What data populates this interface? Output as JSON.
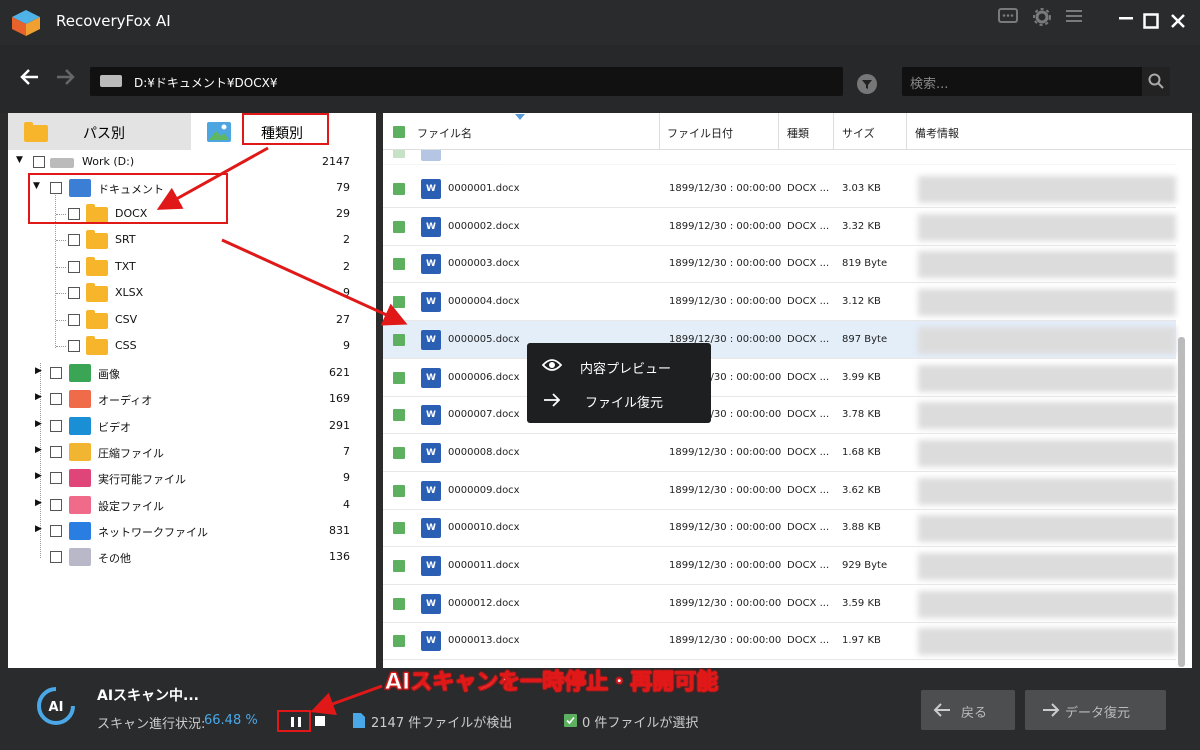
{
  "app": {
    "title": "RecoveryFox AI"
  },
  "nav": {
    "path": "D:¥ドキュメント¥DOCX¥",
    "search_placeholder": "検索..."
  },
  "left": {
    "tabs": {
      "path": "パス別",
      "type": "種類別"
    },
    "drive": {
      "name": "Work (D:)",
      "count": "2147"
    },
    "doc": {
      "name": "ドキュメント",
      "count": "79"
    },
    "subfolders": [
      {
        "name": "DOCX",
        "count": "29"
      },
      {
        "name": "SRT",
        "count": "2"
      },
      {
        "name": "TXT",
        "count": "2"
      },
      {
        "name": "XLSX",
        "count": "9"
      },
      {
        "name": "CSV",
        "count": "27"
      },
      {
        "name": "CSS",
        "count": "9"
      }
    ],
    "categories": [
      {
        "name": "画像",
        "count": "621",
        "color": "#3aa655"
      },
      {
        "name": "オーディオ",
        "count": "169",
        "color": "#f06b4a"
      },
      {
        "name": "ビデオ",
        "count": "291",
        "color": "#1a8fd6"
      },
      {
        "name": "圧縮ファイル",
        "count": "7",
        "color": "#f2b531"
      },
      {
        "name": "実行可能ファイル",
        "count": "9",
        "color": "#e0457a"
      },
      {
        "name": "設定ファイル",
        "count": "4",
        "color": "#f06b8a"
      },
      {
        "name": "ネットワークファイル",
        "count": "831",
        "color": "#2a7de1"
      },
      {
        "name": "その他",
        "count": "136",
        "color": "#b8b8c8"
      }
    ]
  },
  "table": {
    "headers": {
      "name": "ファイル名",
      "date": "ファイル日付",
      "type": "種類",
      "size": "サイズ",
      "note": "備考情報"
    },
    "rows": [
      {
        "name": "0000001.docx",
        "date": "1899/12/30 : 00:00:00",
        "type": "DOCX ...",
        "size": "3.03 KB"
      },
      {
        "name": "0000002.docx",
        "date": "1899/12/30 : 00:00:00",
        "type": "DOCX ...",
        "size": "3.32 KB"
      },
      {
        "name": "0000003.docx",
        "date": "1899/12/30 : 00:00:00",
        "type": "DOCX ...",
        "size": "819 Byte"
      },
      {
        "name": "0000004.docx",
        "date": "1899/12/30 : 00:00:00",
        "type": "DOCX ...",
        "size": "3.12 KB"
      },
      {
        "name": "0000005.docx",
        "date": "1899/12/30 : 00:00:00",
        "type": "DOCX ...",
        "size": "897 Byte"
      },
      {
        "name": "0000006.docx",
        "date": "1899/12/30 : 00:00:00",
        "type": "DOCX ...",
        "size": "3.99 KB"
      },
      {
        "name": "0000007.docx",
        "date": "1899/12/30 : 00:00:00",
        "type": "DOCX ...",
        "size": "3.78 KB"
      },
      {
        "name": "0000008.docx",
        "date": "1899/12/30 : 00:00:00",
        "type": "DOCX ...",
        "size": "1.68 KB"
      },
      {
        "name": "0000009.docx",
        "date": "1899/12/30 : 00:00:00",
        "type": "DOCX ...",
        "size": "3.62 KB"
      },
      {
        "name": "0000010.docx",
        "date": "1899/12/30 : 00:00:00",
        "type": "DOCX ...",
        "size": "3.88 KB"
      },
      {
        "name": "0000011.docx",
        "date": "1899/12/30 : 00:00:00",
        "type": "DOCX ...",
        "size": "929 Byte"
      },
      {
        "name": "0000012.docx",
        "date": "1899/12/30 : 00:00:00",
        "type": "DOCX ...",
        "size": "3.59 KB"
      },
      {
        "name": "0000013.docx",
        "date": "1899/12/30 : 00:00:00",
        "type": "DOCX ...",
        "size": "1.97 KB"
      }
    ]
  },
  "context_menu": {
    "preview": "内容プレビュー",
    "recover": "ファイル復元"
  },
  "scan": {
    "title": "AIスキャン中...",
    "progress_label": "スキャン進行状況:",
    "progress_value": "66.48 %",
    "found": "2147 件ファイルが検出",
    "selected": "0 件ファイルが選択"
  },
  "annotation": {
    "text": "AIスキャンを一時停止・再開可能"
  },
  "buttons": {
    "back": "戻る",
    "recover": "データ復元"
  },
  "colors": {
    "check_green": "#5eb061",
    "annotation_red": "#e01818",
    "accent_blue": "#4aa8e8"
  }
}
